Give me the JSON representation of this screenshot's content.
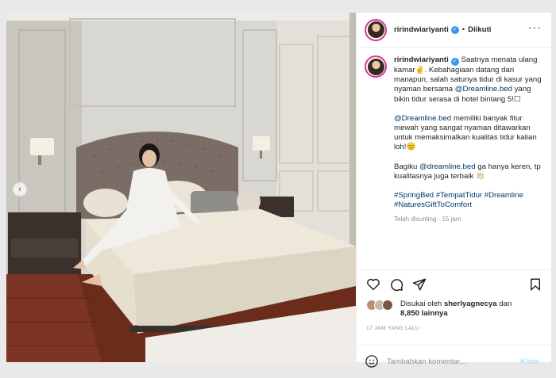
{
  "post": {
    "username": "ririndwiariyanti",
    "follow_status": "Diikuti",
    "more_icon": "more-horizontal-icon",
    "caption": {
      "p1": "Saatnya menata ulang kamar✌️. Kebahagiaan datang dari manapun, salah satunya tidur di kasur yang nyaman bersama",
      "p1_tag": "@Dreamline.bed",
      "p1_tail": "yang bikin tidur serasa di hotel bintang 5!☐",
      "p2_tag": "@Dreamline.bed",
      "p2": "memiliki banyak fitur mewah yang sangat nyaman ditawarkan untuk memaksimalkan kualitas tidur kalian loh!😊",
      "p3_head": "Bagiku",
      "p3_tag": "@dreamline.bed",
      "p3": "ga hanya keren, tp kualitasnya juga terbaik 👏🏻",
      "hashtags_1": "#SpringBed #TempatTidur #Dreamline",
      "hashtags_2": "#NaturesGiftToComfort",
      "edited": "Telah disunting",
      "edited_time": "15 jam"
    },
    "likes": {
      "prefix": "Disukai oleh",
      "user": "sherlyagnecya",
      "connector": "dan",
      "count": "8,850 lainnya"
    },
    "time_ago": "17 JAM YANG LALU",
    "comment": {
      "placeholder": "Tambahkan komentar...",
      "post_label": "Kirim"
    }
  },
  "colors": {
    "link": "#00376b",
    "verified": "#3897f0",
    "story_ring": "#d1399a",
    "post_disabled": "#b2dffc"
  }
}
